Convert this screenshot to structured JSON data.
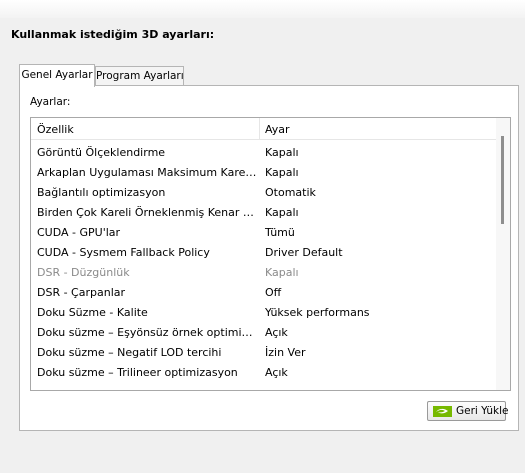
{
  "heading": "Kullanmak istediğim 3D ayarları:",
  "tabs": [
    {
      "label": "Genel Ayarlar",
      "active": true
    },
    {
      "label": "Program Ayarları",
      "active": false
    }
  ],
  "panel": {
    "settings_label": "Ayarlar:",
    "columns": {
      "feature": "Özellik",
      "setting": "Ayar"
    },
    "rows": [
      {
        "feature": "Görüntü Ölçeklendirme",
        "setting": "Kapalı"
      },
      {
        "feature": "Arkaplan Uygulaması Maksimum Kare Hızı",
        "setting": "Kapalı"
      },
      {
        "feature": "Bağlantılı optimizasyon",
        "setting": "Otomatik"
      },
      {
        "feature": "Birden Çok Kareli Örneklenmiş Kenar Yumuşatma (MFAA)",
        "setting": "Kapalı"
      },
      {
        "feature": "CUDA - GPU'lar",
        "setting": "Tümü"
      },
      {
        "feature": "CUDA - Sysmem Fallback Policy",
        "setting": "Driver Default"
      },
      {
        "feature": "DSR - Düzgünlük",
        "setting": "Kapalı",
        "disabled": true
      },
      {
        "feature": "DSR - Çarpanlar",
        "setting": "Off"
      },
      {
        "feature": "Doku Süzme - Kalite",
        "setting": "Yüksek performans"
      },
      {
        "feature": "Doku süzme – Eşyönsüz örnek optimizasyonu",
        "setting": "Açık"
      },
      {
        "feature": "Doku süzme – Negatif LOD tercihi",
        "setting": "İzin Ver"
      },
      {
        "feature": "Doku süzme – Trilineer optimizasyon",
        "setting": "Açık"
      }
    ],
    "restore_button": "Geri Yükle"
  },
  "colors": {
    "accent": "#76b900",
    "disabled_text": "#8a8a8a"
  },
  "icons": {
    "restore": "nvidia-logo-icon"
  }
}
